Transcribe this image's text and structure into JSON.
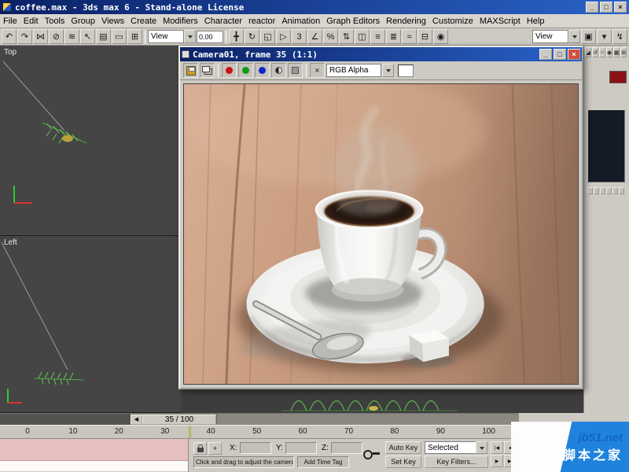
{
  "window": {
    "title": "coffee.max - 3ds max 6 - Stand-alone License",
    "minimize": "_",
    "maximize": "□",
    "close": "×"
  },
  "menu": {
    "items": [
      "File",
      "Edit",
      "Tools",
      "Group",
      "Views",
      "Create",
      "Modifiers",
      "Character",
      "reactor",
      "Animation",
      "Graph Editors",
      "Rendering",
      "Customize",
      "MAXScript",
      "Help"
    ]
  },
  "toolbar": {
    "icons_left": [
      {
        "name": "undo-icon",
        "glyph": "↶"
      },
      {
        "name": "redo-icon",
        "glyph": "↷"
      },
      {
        "name": "select-and-link-icon",
        "glyph": "⋈"
      },
      {
        "name": "unlink-selection-icon",
        "glyph": "⊘"
      },
      {
        "name": "bind-to-spacewarp-icon",
        "glyph": "≋"
      },
      {
        "name": "select-object-icon",
        "glyph": "↖"
      },
      {
        "name": "select-by-name-icon",
        "glyph": "▤"
      },
      {
        "name": "rectangular-selection-icon",
        "glyph": "▭"
      },
      {
        "name": "window-crossing-icon",
        "glyph": "⊞"
      }
    ],
    "coord_system_value": "View",
    "spinner_value": "0.00",
    "icons_mid": [
      {
        "name": "select-and-move-icon",
        "glyph": "╋"
      },
      {
        "name": "select-and-rotate-icon",
        "glyph": "↻"
      },
      {
        "name": "select-and-scale-icon",
        "glyph": "◱"
      },
      {
        "name": "select-and-manipulate-icon",
        "glyph": "▷"
      },
      {
        "name": "snap-toggle-icon",
        "glyph": "3"
      },
      {
        "name": "angle-snap-icon",
        "glyph": "∠"
      },
      {
        "name": "percent-snap-icon",
        "glyph": "%"
      },
      {
        "name": "spinner-snap-icon",
        "glyph": "⇅"
      },
      {
        "name": "mirror-icon",
        "glyph": "◫"
      },
      {
        "name": "align-icon",
        "glyph": "≡"
      },
      {
        "name": "layer-manager-icon",
        "glyph": "≣"
      },
      {
        "name": "curve-editor-icon",
        "glyph": "≈"
      },
      {
        "name": "schematic-view-icon",
        "glyph": "⊟"
      },
      {
        "name": "material-editor-icon",
        "glyph": "◉"
      }
    ],
    "view_dropdown_value": "View",
    "icons_right": [
      {
        "name": "render-scene-icon",
        "glyph": "▣"
      },
      {
        "name": "render-type-icon",
        "glyph": "▾"
      },
      {
        "name": "quick-render-icon",
        "glyph": "↯"
      }
    ]
  },
  "viewports": {
    "top_label": "Top",
    "left_label": "Left"
  },
  "render_window": {
    "title": "Camera01, frame 35 (1:1)",
    "minimize": "_",
    "maximize": "□",
    "close": "×",
    "clear_glyph": "×",
    "channel_value": "RGB Alpha"
  },
  "command_panel": {
    "tabs": [
      {
        "name": "tab-create",
        "glyph": "◢"
      },
      {
        "name": "tab-modify",
        "glyph": "↺"
      },
      {
        "name": "tab-hierarchy",
        "glyph": "⌂"
      },
      {
        "name": "tab-motion",
        "glyph": "◉"
      },
      {
        "name": "tab-display",
        "glyph": "▦"
      },
      {
        "name": "tab-utilities",
        "glyph": "⊞"
      }
    ]
  },
  "timeline": {
    "slider_arrow": "◀",
    "frame_display": "35 / 100",
    "ticks": [
      "0",
      "10",
      "20",
      "30",
      "40",
      "50",
      "60",
      "70",
      "80",
      "90",
      "100"
    ]
  },
  "status": {
    "mode_glyph": "+",
    "x_label": "X:",
    "y_label": "Y:",
    "z_label": "Z:",
    "prompt": "Click and drag to adjust the camera",
    "add_time_tag": "Add Time Tag",
    "auto_key": "Auto Key",
    "set_key": "Set Key",
    "selected_value": "Selected",
    "key_filters": "Key Filters...",
    "transport": [
      {
        "name": "go-to-start-button",
        "glyph": "|◀"
      },
      {
        "name": "previous-frame-button",
        "glyph": "◀"
      },
      {
        "name": "next-frame-button",
        "glyph": "▶"
      },
      {
        "name": "go-to-end-button",
        "glyph": "▶|"
      }
    ]
  },
  "watermark": {
    "site": "jb51.net",
    "name": "脚本之家"
  }
}
